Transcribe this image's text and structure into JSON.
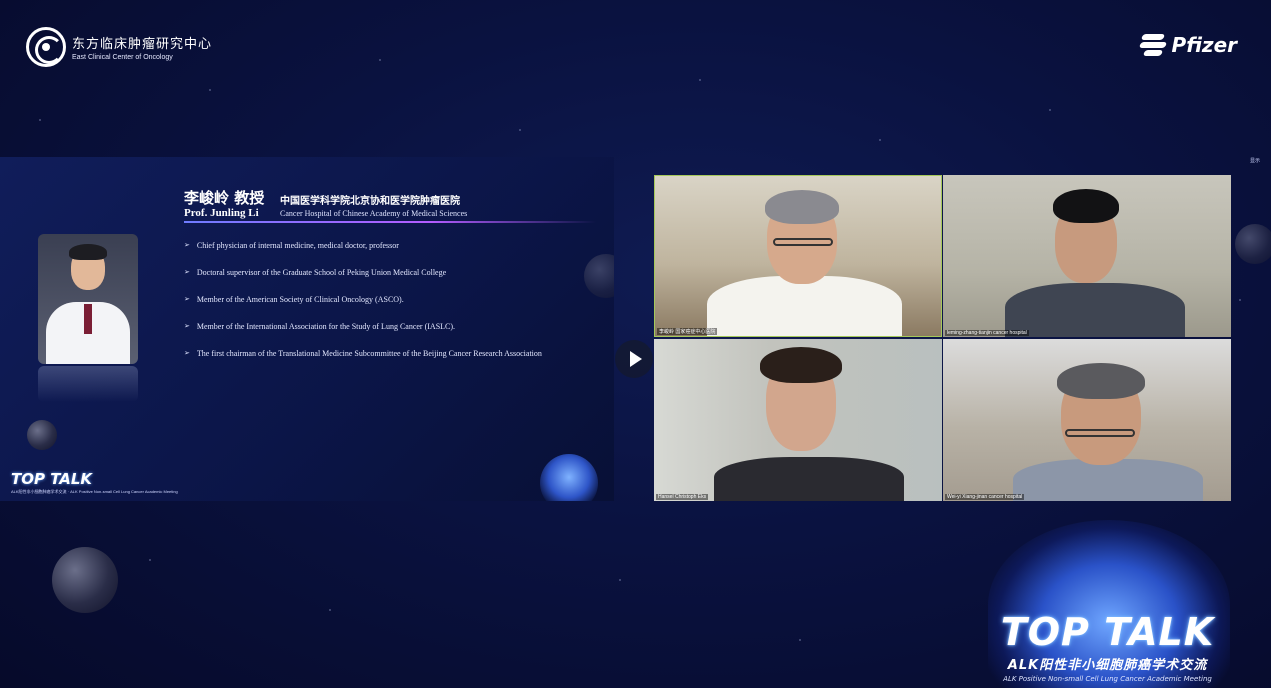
{
  "header": {
    "org_cn": "东方临床肿瘤研究中心",
    "org_en": "East Clinical Center of Oncology",
    "sponsor": "Pfizer"
  },
  "slide": {
    "name_cn": "李峻岭 教授",
    "name_en": "Prof. Junling Li",
    "hospital_cn": "中国医学科学院北京协和医学院肿瘤医院",
    "hospital_en": "Cancer Hospital of Chinese Academy of Medical Sciences",
    "bullet_marker": "➢",
    "bullets": [
      "Chief physician of internal medicine, medical doctor, professor",
      "Doctoral supervisor of the Graduate School of Peking Union Medical College",
      "Member of the American Society of Clinical Oncology (ASCO).",
      "Member of the International Association for the Study of Lung Cancer (IASLC).",
      "The first chairman of the Translational Medicine Subcommittee of the Beijing Cancer Research Association"
    ],
    "logo_title": "TOP TALK",
    "logo_subtitle": "ALK阳性非小细胞肺癌学术交流 · ALK Positive Non-small Cell Lung Cancer Academic Meeting"
  },
  "video": {
    "tiles": [
      {
        "label": "李峻岭 国家癌症中心医院"
      },
      {
        "label": "leming-zhang-tianjin cancer hospital"
      },
      {
        "label": "Hansel Christoph Eks"
      },
      {
        "label": "Wei-yi Xiang-jinan cancer hospital"
      }
    ],
    "corner_label": "显示"
  },
  "banner": {
    "title": "TOP TALK",
    "subtitle_cn": "ALK阳性非小细胞肺癌学术交流",
    "subtitle_en": "ALK Positive Non-small Cell Lung Cancer Academic Meeting"
  }
}
